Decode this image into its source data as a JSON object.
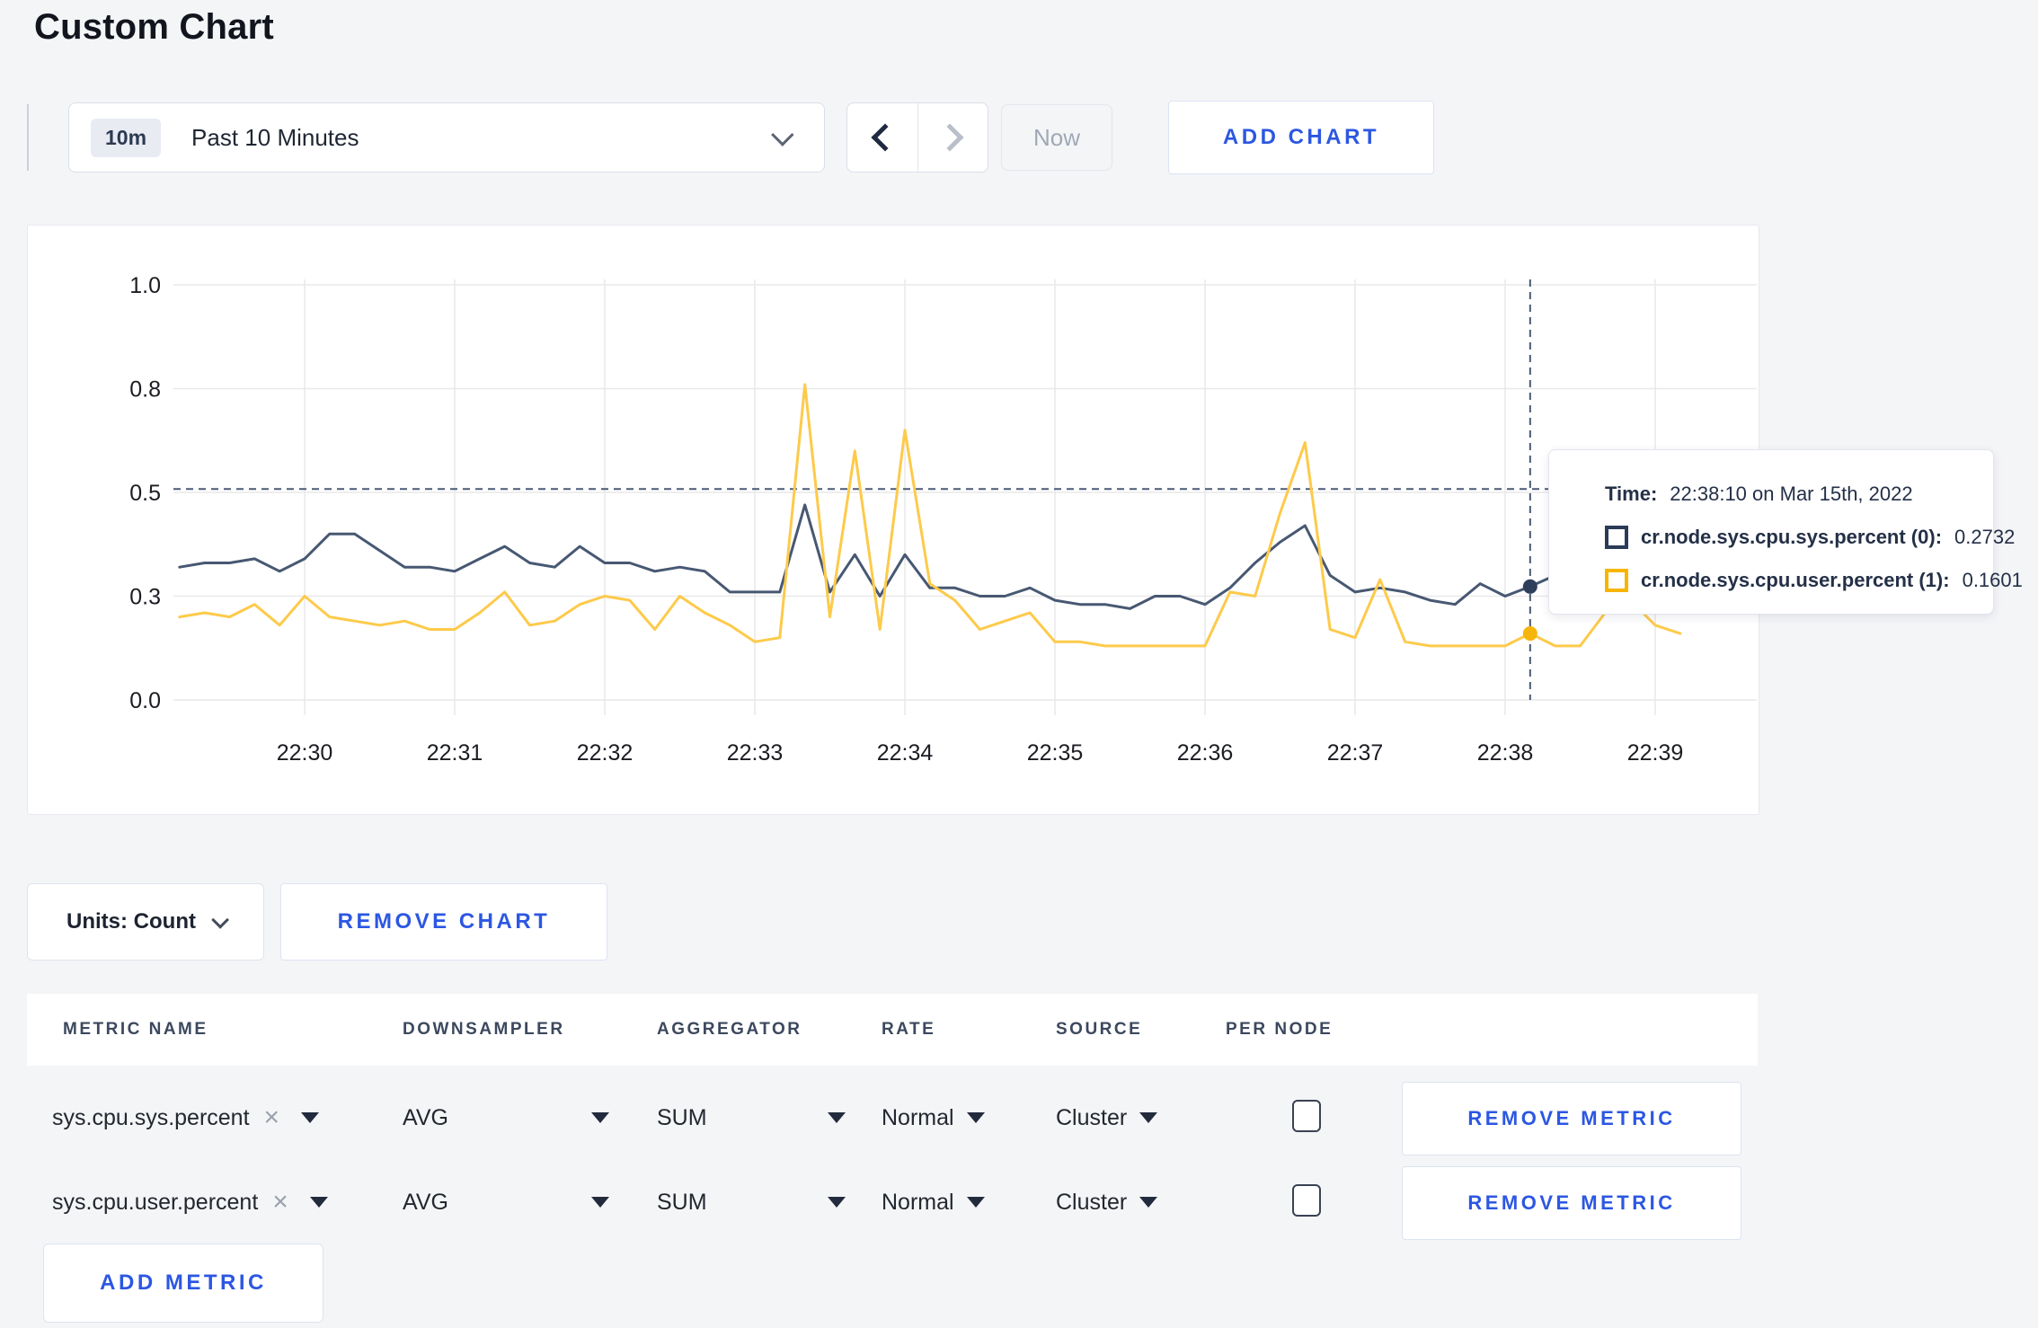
{
  "page": {
    "title": "Custom Chart"
  },
  "toolbar": {
    "time_range": {
      "badge": "10m",
      "label": "Past 10 Minutes"
    },
    "now_label": "Now",
    "add_chart_label": "ADD CHART"
  },
  "chart_data": {
    "type": "line",
    "title": "",
    "ylabel": "",
    "xlabel": "",
    "ylim": [
      0,
      1
    ],
    "grid": true,
    "y_ticks": [
      {
        "value": 0.0,
        "label": "0.0"
      },
      {
        "value": 0.25,
        "label": "0.3"
      },
      {
        "value": 0.5,
        "label": "0.5"
      },
      {
        "value": 0.75,
        "label": "0.8"
      },
      {
        "value": 1.0,
        "label": "1.0"
      }
    ],
    "x_tick_labels": [
      "22:30",
      "22:31",
      "22:32",
      "22:33",
      "22:34",
      "22:35",
      "22:36",
      "22:37",
      "22:38",
      "22:39"
    ],
    "x_tick_indices": [
      5,
      11,
      17,
      23,
      29,
      35,
      41,
      47,
      53,
      59
    ],
    "points_per_minute": 6,
    "x_start_time": "22:29:10",
    "series": [
      {
        "name": "cr.node.sys.cpu.sys.percent",
        "color": "#475872",
        "marker_color": "#2e3f5c",
        "values": [
          0.32,
          0.33,
          0.33,
          0.34,
          0.31,
          0.34,
          0.4,
          0.4,
          0.36,
          0.32,
          0.32,
          0.31,
          0.34,
          0.37,
          0.33,
          0.32,
          0.37,
          0.33,
          0.33,
          0.31,
          0.32,
          0.31,
          0.26,
          0.26,
          0.26,
          0.47,
          0.26,
          0.35,
          0.25,
          0.35,
          0.27,
          0.27,
          0.25,
          0.25,
          0.27,
          0.24,
          0.23,
          0.23,
          0.22,
          0.25,
          0.25,
          0.23,
          0.27,
          0.33,
          0.38,
          0.42,
          0.3,
          0.26,
          0.27,
          0.26,
          0.24,
          0.23,
          0.28,
          0.25,
          0.2732,
          0.3,
          0.31,
          0.29,
          0.3,
          0.3,
          0.3
        ]
      },
      {
        "name": "cr.node.sys.cpu.user.percent",
        "color": "#fdca4a",
        "marker_color": "#f5b50a",
        "values": [
          0.2,
          0.21,
          0.2,
          0.23,
          0.18,
          0.25,
          0.2,
          0.19,
          0.18,
          0.19,
          0.17,
          0.17,
          0.21,
          0.26,
          0.18,
          0.19,
          0.23,
          0.25,
          0.24,
          0.17,
          0.25,
          0.21,
          0.18,
          0.14,
          0.15,
          0.76,
          0.2,
          0.6,
          0.17,
          0.65,
          0.28,
          0.24,
          0.17,
          0.19,
          0.21,
          0.14,
          0.14,
          0.13,
          0.13,
          0.13,
          0.13,
          0.13,
          0.26,
          0.25,
          0.45,
          0.62,
          0.17,
          0.15,
          0.29,
          0.14,
          0.13,
          0.13,
          0.13,
          0.13,
          0.1601,
          0.13,
          0.13,
          0.21,
          0.24,
          0.18,
          0.16
        ]
      }
    ],
    "crosshair": {
      "index": 54,
      "y_value": 0.508,
      "dash_color": "#4a5a75"
    },
    "gridline_color": "#e9e9e9",
    "tick_label_color": "#1b1d22"
  },
  "chart_tooltip": {
    "time_label": "Time:",
    "time_value": "22:38:10 on Mar 15th, 2022",
    "rows": [
      {
        "label": "cr.node.sys.cpu.sys.percent (0):",
        "value": "0.2732",
        "color": "#2a3b57"
      },
      {
        "label": "cr.node.sys.cpu.user.percent (1):",
        "value": "0.1601",
        "color": "#f7b500"
      }
    ]
  },
  "chart_footer": {
    "units_label": "Units: Count",
    "remove_chart_label": "REMOVE CHART"
  },
  "metrics_table": {
    "headers": [
      "METRIC NAME",
      "DOWNSAMPLER",
      "AGGREGATOR",
      "RATE",
      "SOURCE",
      "PER NODE"
    ],
    "rows": [
      {
        "metric": "sys.cpu.sys.percent",
        "downsampler": "AVG",
        "aggregator": "SUM",
        "rate": "Normal",
        "source": "Cluster",
        "per_node_checked": false,
        "remove_label": "REMOVE METRIC"
      },
      {
        "metric": "sys.cpu.user.percent",
        "downsampler": "AVG",
        "aggregator": "SUM",
        "rate": "Normal",
        "source": "Cluster",
        "per_node_checked": false,
        "remove_label": "REMOVE METRIC"
      }
    ],
    "add_metric_label": "ADD METRIC"
  }
}
